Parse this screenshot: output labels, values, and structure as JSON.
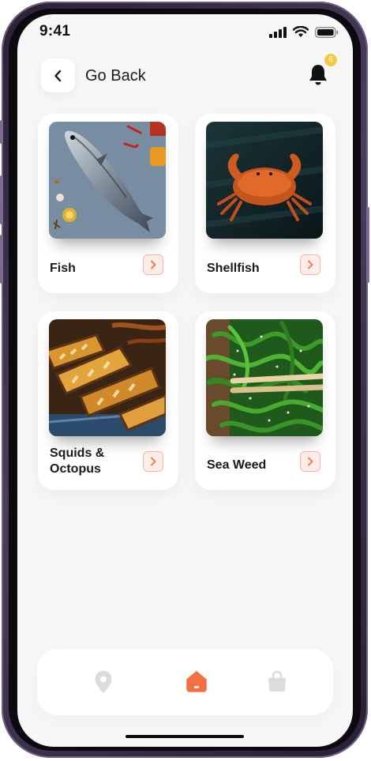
{
  "status_bar": {
    "time": "9:41"
  },
  "header": {
    "back_label": "Go Back",
    "notification_count": "6"
  },
  "categories": [
    {
      "label": "Fish"
    },
    {
      "label": "Shellfish"
    },
    {
      "label": "Squids & Octopus"
    },
    {
      "label": "Sea Weed"
    }
  ],
  "nav": {
    "items": [
      "location-icon",
      "home-icon",
      "bag-icon"
    ],
    "active": "home-icon"
  },
  "colors": {
    "accent": "#f36f45",
    "badge": "#f7c844",
    "inactive": "#dcdcdc"
  }
}
